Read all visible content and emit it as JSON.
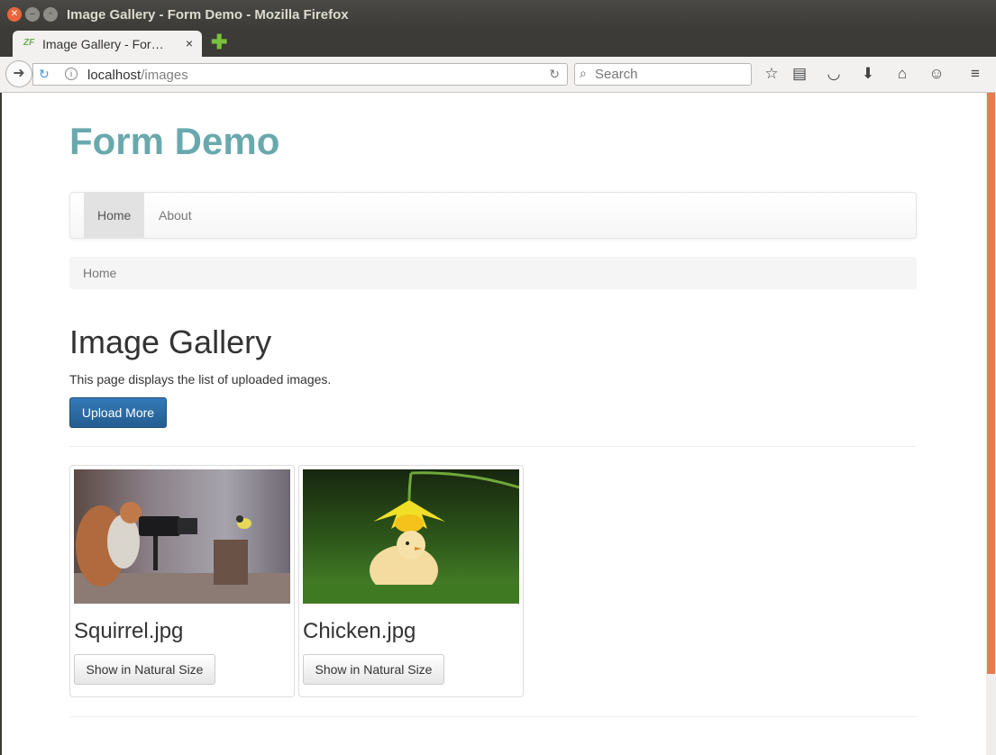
{
  "window": {
    "title": "Image Gallery - Form Demo - Mozilla Firefox"
  },
  "tab": {
    "label": "Image Gallery - For…",
    "close": "×",
    "new_tab": "✚"
  },
  "urlbar": {
    "host": "localhost",
    "path": "/images"
  },
  "search": {
    "placeholder": "Search"
  },
  "site": {
    "brand": "Form Demo",
    "nav": [
      {
        "label": "Home",
        "active": true
      },
      {
        "label": "About",
        "active": false
      }
    ],
    "breadcrumb": "Home"
  },
  "page": {
    "heading": "Image Gallery",
    "description": "This page displays the list of uploaded images.",
    "upload_button": "Upload More"
  },
  "gallery": [
    {
      "filename": "Squirrel.jpg",
      "button": "Show in Natural Size"
    },
    {
      "filename": "Chicken.jpg",
      "button": "Show in Natural Size"
    }
  ],
  "colors": {
    "brand": "#69a9ae",
    "primary_button": "#337ab7",
    "scroll_thumb": "#e57d4e"
  },
  "icons": {
    "back": "back-arrow-icon",
    "reload": "reload-icon",
    "info": "info-icon",
    "search": "search-icon",
    "bookmark": "star-icon",
    "reader": "reading-list-icon",
    "pocket": "pocket-icon",
    "download": "download-icon",
    "home": "home-icon",
    "hello": "chat-icon",
    "menu": "hamburger-menu-icon"
  }
}
